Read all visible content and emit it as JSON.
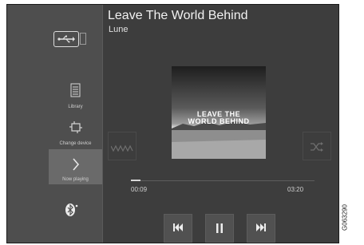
{
  "header": {
    "title": "Leave The World Behind",
    "artist": "Lune"
  },
  "source": {
    "icon": "usb-icon",
    "suffix_icon": "media-source-icon"
  },
  "nav": {
    "library": {
      "label": "Library",
      "icon": "list-icon"
    },
    "change_device": {
      "label": "Change device",
      "icon": "change-device-icon"
    },
    "now_playing": {
      "label": "Now playing",
      "icon": "chevron-right-icon"
    },
    "bluetooth": {
      "icon": "bluetooth-icon"
    }
  },
  "album_art": {
    "text_line1": "LEAVE THE",
    "text_line2": "WORLD BEHIND"
  },
  "progress": {
    "elapsed": "00:09",
    "total": "03:20",
    "fraction": 0.05
  },
  "controls": {
    "prev_icon": "skip-previous-icon",
    "pause_icon": "pause-icon",
    "next_icon": "skip-next-icon",
    "shuffle_icon": "shuffle-icon",
    "repeat_icon": "repeat-icon"
  },
  "figure_code": "G063290",
  "colors": {
    "screen_bg": "#3d3d3d",
    "sidebar_bg": "#4e4e4e",
    "active_bg": "#6a6a6a",
    "text": "#f2f2f2"
  }
}
